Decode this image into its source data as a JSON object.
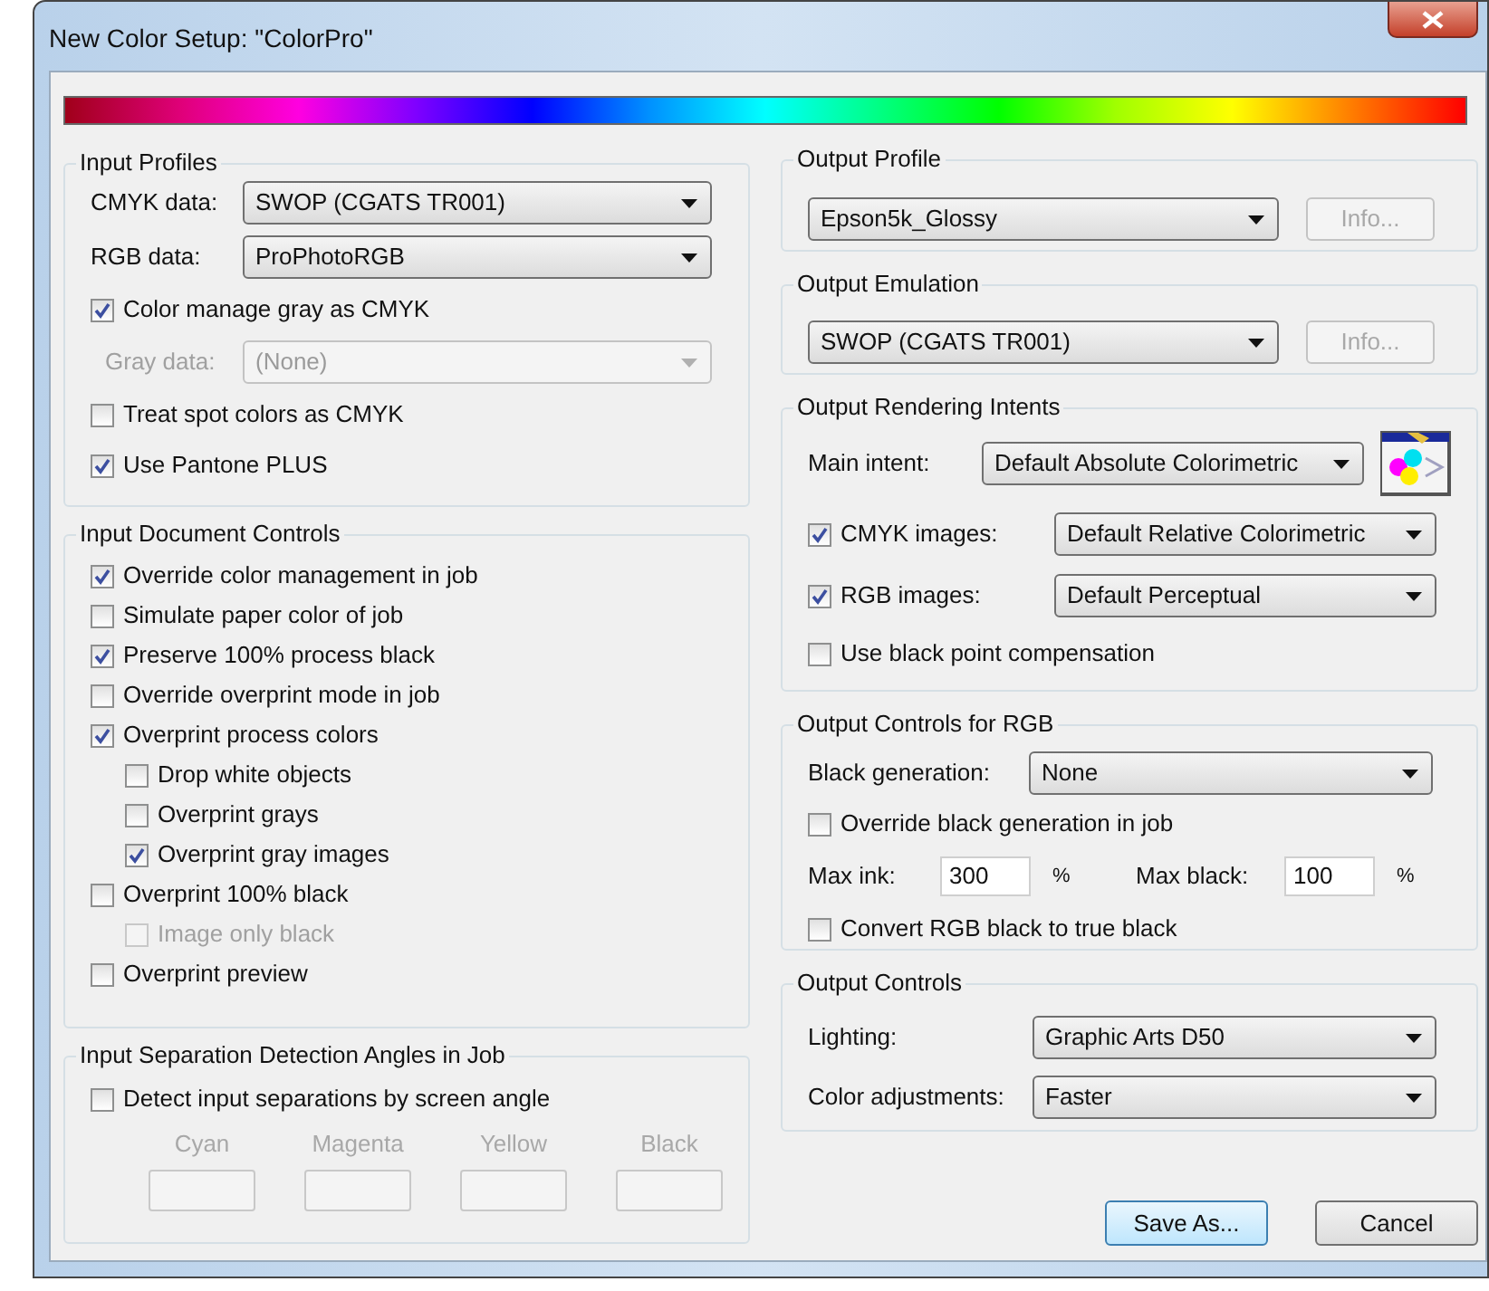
{
  "window": {
    "title": "New Color Setup: \"ColorPro\""
  },
  "left_groups": [
    {
      "title": "Input Profiles",
      "items": [
        {
          "kind": "select",
          "label": "CMYK data:",
          "value": "SWOP (CGATS TR001)",
          "disabled": false
        },
        {
          "kind": "select",
          "label": "RGB data:",
          "value": "ProPhotoRGB",
          "disabled": false
        },
        {
          "kind": "checkbox",
          "label": "Color manage gray as CMYK",
          "checked": true,
          "disabled": false
        },
        {
          "kind": "select",
          "label": "Gray data:",
          "value": "(None)",
          "disabled": true
        },
        {
          "kind": "checkbox",
          "label": "Treat spot colors as CMYK",
          "checked": false,
          "disabled": false
        },
        {
          "kind": "checkbox",
          "label": "Use Pantone PLUS",
          "checked": true,
          "disabled": false
        }
      ]
    },
    {
      "title": "Input Document Controls",
      "items": [
        {
          "kind": "checkbox",
          "label": "Override color management in job",
          "checked": true,
          "disabled": false
        },
        {
          "kind": "checkbox",
          "label": "Simulate paper color of job",
          "checked": false,
          "disabled": false
        },
        {
          "kind": "checkbox",
          "label": "Preserve 100% process black",
          "checked": true,
          "disabled": false
        },
        {
          "kind": "checkbox",
          "label": "Override overprint mode in job",
          "checked": false,
          "disabled": false
        },
        {
          "kind": "checkbox",
          "label": "Overprint process colors",
          "checked": true,
          "disabled": false,
          "children": [
            {
              "label": "Drop white objects",
              "checked": false,
              "disabled": false
            },
            {
              "label": "Overprint grays",
              "checked": false,
              "disabled": false
            },
            {
              "label": "Overprint gray images",
              "checked": true,
              "disabled": false
            }
          ]
        },
        {
          "kind": "checkbox",
          "label": "Overprint 100% black",
          "checked": false,
          "disabled": false,
          "children": [
            {
              "label": "Image only black",
              "checked": false,
              "disabled": true
            }
          ]
        },
        {
          "kind": "checkbox",
          "label": "Overprint preview",
          "checked": false,
          "disabled": false
        }
      ]
    },
    {
      "title": "Input Separation Detection Angles in Job",
      "items": [
        {
          "kind": "checkbox",
          "label": "Detect input separations by screen angle",
          "checked": false,
          "disabled": false
        },
        {
          "kind": "angles",
          "disabled": true,
          "fields": [
            {
              "label": "Cyan"
            },
            {
              "label": "Magenta"
            },
            {
              "label": "Yellow"
            },
            {
              "label": "Black"
            }
          ]
        }
      ]
    }
  ],
  "right_groups": [
    {
      "title": "Output Profile",
      "items": [
        {
          "kind": "select",
          "value": "Epson5k_Glossy",
          "disabled": false,
          "info": {
            "label": "Info...",
            "disabled": true
          }
        }
      ]
    },
    {
      "title": "Output Emulation",
      "items": [
        {
          "kind": "select",
          "value": "SWOP (CGATS TR001)",
          "disabled": false,
          "info": {
            "label": "Info...",
            "disabled": true
          }
        }
      ]
    },
    {
      "title": "Output Rendering Intents",
      "items": [
        {
          "kind": "select_picker",
          "label": "Main intent:",
          "value": "Default Absolute Colorimetric",
          "disabled": false
        },
        {
          "kind": "check_select",
          "label": "CMYK images:",
          "checked": true,
          "value": "Default Relative Colorimetric"
        },
        {
          "kind": "check_select",
          "label": "RGB images:",
          "checked": true,
          "value": "Default Perceptual"
        },
        {
          "kind": "checkbox",
          "label": "Use black point compensation",
          "checked": false,
          "disabled": false
        }
      ]
    },
    {
      "title": "Output Controls for RGB",
      "items": [
        {
          "kind": "select",
          "label": "Black generation:",
          "value": "None",
          "disabled": false
        },
        {
          "kind": "checkbox",
          "label": "Override black generation in job",
          "checked": false,
          "disabled": false
        },
        {
          "kind": "numbers",
          "fields": [
            {
              "label": "Max ink:",
              "value": "300",
              "unit": "%"
            },
            {
              "label": "Max black:",
              "value": "100",
              "unit": "%"
            }
          ]
        },
        {
          "kind": "checkbox",
          "label": "Convert RGB black to true black",
          "checked": false,
          "disabled": false
        }
      ]
    },
    {
      "title": "Output Controls",
      "items": [
        {
          "kind": "select",
          "label": "Lighting:",
          "value": "Graphic Arts D50",
          "disabled": false
        },
        {
          "kind": "select",
          "label": "Color adjustments:",
          "value": "Faster",
          "disabled": false
        }
      ]
    }
  ],
  "buttons": [
    {
      "label": "Save As...",
      "default": true
    },
    {
      "label": "Cancel",
      "default": false
    }
  ]
}
